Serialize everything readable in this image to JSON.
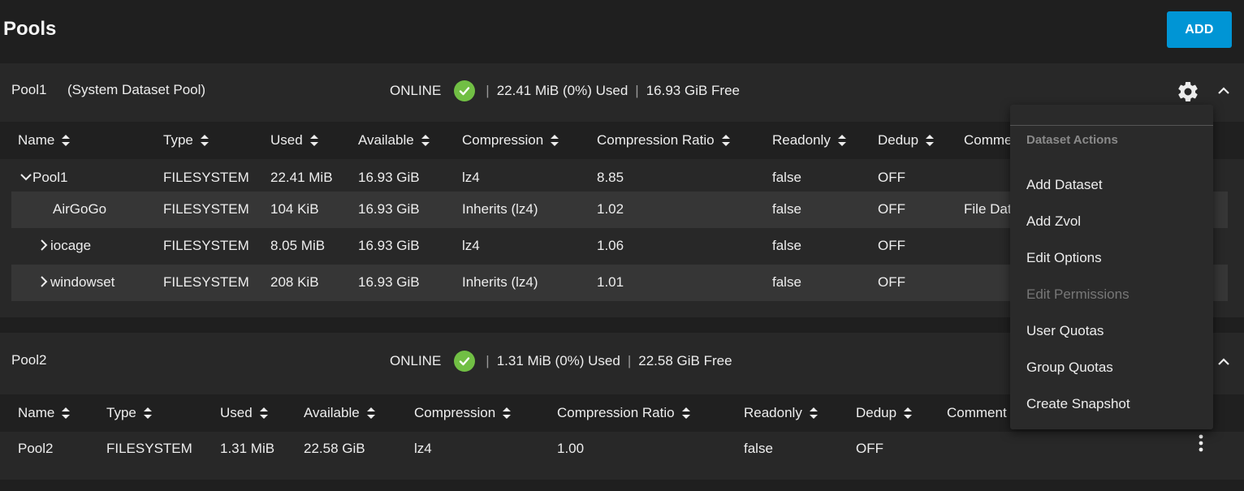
{
  "page": {
    "title": "Pools",
    "add_label": "ADD"
  },
  "columns_pool1": [
    "Name",
    "Type",
    "Used",
    "Available",
    "Compression",
    "Compression Ratio",
    "Readonly",
    "Dedup",
    "Comme"
  ],
  "columns_pool2": [
    "Name",
    "Type",
    "Used",
    "Available",
    "Compression",
    "Compression Ratio",
    "Readonly",
    "Dedup",
    "Comment"
  ],
  "pools": [
    {
      "name": "Pool1",
      "subtitle": "(System Dataset Pool)",
      "status": "ONLINE",
      "used": "22.41 MiB (0%) Used",
      "free": "16.93 GiB Free",
      "rows": [
        {
          "name": "Pool1",
          "type": "FILESYSTEM",
          "used": "22.41 MiB",
          "available": "16.93 GiB",
          "compression": "lz4",
          "ratio": "8.85",
          "readonly": "false",
          "dedup": "OFF",
          "comment": ""
        },
        {
          "name": "AirGoGo",
          "type": "FILESYSTEM",
          "used": "104 KiB",
          "available": "16.93 GiB",
          "compression": "Inherits (lz4)",
          "ratio": "1.02",
          "readonly": "false",
          "dedup": "OFF",
          "comment": "File Dat"
        },
        {
          "name": "iocage",
          "type": "FILESYSTEM",
          "used": "8.05 MiB",
          "available": "16.93 GiB",
          "compression": "lz4",
          "ratio": "1.06",
          "readonly": "false",
          "dedup": "OFF",
          "comment": ""
        },
        {
          "name": "windowset",
          "type": "FILESYSTEM",
          "used": "208 KiB",
          "available": "16.93 GiB",
          "compression": "Inherits (lz4)",
          "ratio": "1.01",
          "readonly": "false",
          "dedup": "OFF",
          "comment": ""
        }
      ]
    },
    {
      "name": "Pool2",
      "status": "ONLINE",
      "used": "1.31 MiB (0%) Used",
      "free": "22.58 GiB Free",
      "rows": [
        {
          "name": "Pool2",
          "type": "FILESYSTEM",
          "used": "1.31 MiB",
          "available": "22.58 GiB",
          "compression": "lz4",
          "ratio": "1.00",
          "readonly": "false",
          "dedup": "OFF",
          "comment": ""
        }
      ]
    }
  ],
  "menu": {
    "header": "Dataset Actions",
    "items": [
      "Add Dataset",
      "Add Zvol",
      "Edit Options",
      "Edit Permissions",
      "User Quotas",
      "Group Quotas",
      "Create Snapshot"
    ]
  },
  "icons": {
    "status_ok": "check-circle-icon",
    "settings": "gear-icon",
    "collapse": "chevron-up-icon",
    "sort": "sort-icon",
    "row_actions": "kebab-icon"
  },
  "colors": {
    "accent": "#0095d5",
    "online": "#71bf44"
  }
}
